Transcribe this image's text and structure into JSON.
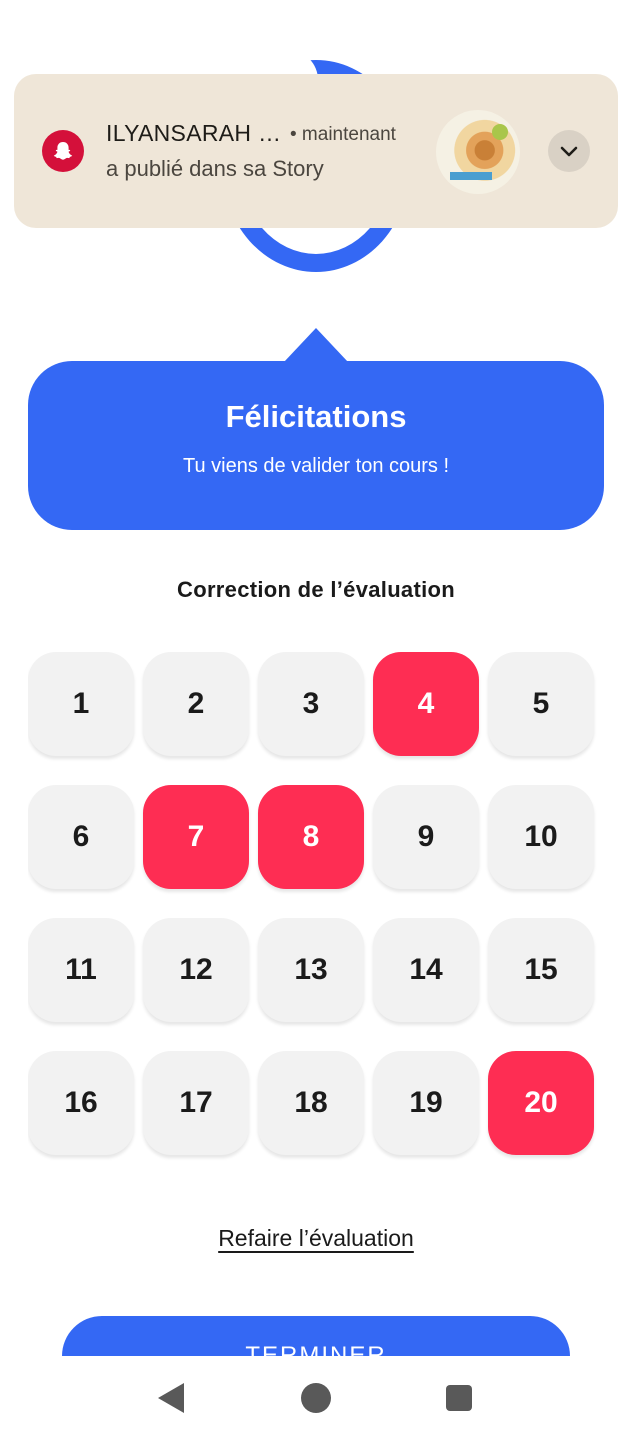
{
  "notification": {
    "app_icon": "snapchat-ghost-icon",
    "title": "ILYANSARAH …",
    "time": "• maintenant",
    "message": "a publié dans sa Story",
    "expand_icon": "chevron-down-icon",
    "accent_color": "#d4103a"
  },
  "result": {
    "title": "Félicitations",
    "subtitle": "Tu viens de valider ton cours !",
    "color": "#3468f4"
  },
  "correction": {
    "title": "Correction de l’évaluation",
    "wrong_color": "#fe2d53",
    "questions": [
      {
        "label": "1",
        "status": "correct"
      },
      {
        "label": "2",
        "status": "correct"
      },
      {
        "label": "3",
        "status": "correct"
      },
      {
        "label": "4",
        "status": "wrong"
      },
      {
        "label": "5",
        "status": "correct"
      },
      {
        "label": "6",
        "status": "correct"
      },
      {
        "label": "7",
        "status": "wrong"
      },
      {
        "label": "8",
        "status": "wrong"
      },
      {
        "label": "9",
        "status": "correct"
      },
      {
        "label": "10",
        "status": "correct"
      },
      {
        "label": "11",
        "status": "correct"
      },
      {
        "label": "12",
        "status": "correct"
      },
      {
        "label": "13",
        "status": "correct"
      },
      {
        "label": "14",
        "status": "correct"
      },
      {
        "label": "15",
        "status": "correct"
      },
      {
        "label": "16",
        "status": "correct"
      },
      {
        "label": "17",
        "status": "correct"
      },
      {
        "label": "18",
        "status": "correct"
      },
      {
        "label": "19",
        "status": "correct"
      },
      {
        "label": "20",
        "status": "wrong"
      }
    ]
  },
  "actions": {
    "redo_label": "Refaire l’évaluation",
    "finish_label": "TERMINER"
  },
  "navbar": {
    "back_icon": "back-triangle-icon",
    "home_icon": "home-circle-icon",
    "recents_icon": "recents-square-icon"
  }
}
